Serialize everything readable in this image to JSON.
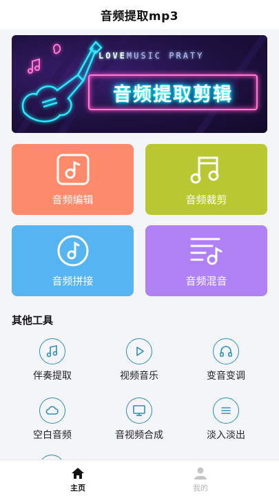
{
  "header": {
    "title": "音频提取mp3"
  },
  "banner": {
    "love_text": "LOVE",
    "love_rest": "MUSIC PRATY",
    "headline": "音频提取剪辑"
  },
  "features": [
    {
      "label": "音频编辑",
      "icon": "music-square-icon",
      "color": "#fd8a6b"
    },
    {
      "label": "音频裁剪",
      "icon": "double-note-icon",
      "color": "#b9c832"
    },
    {
      "label": "音频拼接",
      "icon": "music-disc-icon",
      "color": "#56b4f1"
    },
    {
      "label": "音频混音",
      "icon": "playlist-note-icon",
      "color": "#b080f5"
    }
  ],
  "other_tools": {
    "title": "其他工具",
    "items": [
      {
        "label": "伴奏提取",
        "icon": "music-note-icon"
      },
      {
        "label": "视频音乐",
        "icon": "play-icon"
      },
      {
        "label": "变音变调",
        "icon": "headphones-icon"
      },
      {
        "label": "空白音频",
        "icon": "cloud-icon"
      },
      {
        "label": "音视频合成",
        "icon": "monitor-icon"
      },
      {
        "label": "淡入淡出",
        "icon": "menu-lines-icon"
      }
    ]
  },
  "tabbar": {
    "home": "主页",
    "mine": "我的"
  },
  "colors": {
    "accent": "#2c8fb3",
    "tab_active": "#111111",
    "tab_inactive": "#b5b5b5"
  }
}
